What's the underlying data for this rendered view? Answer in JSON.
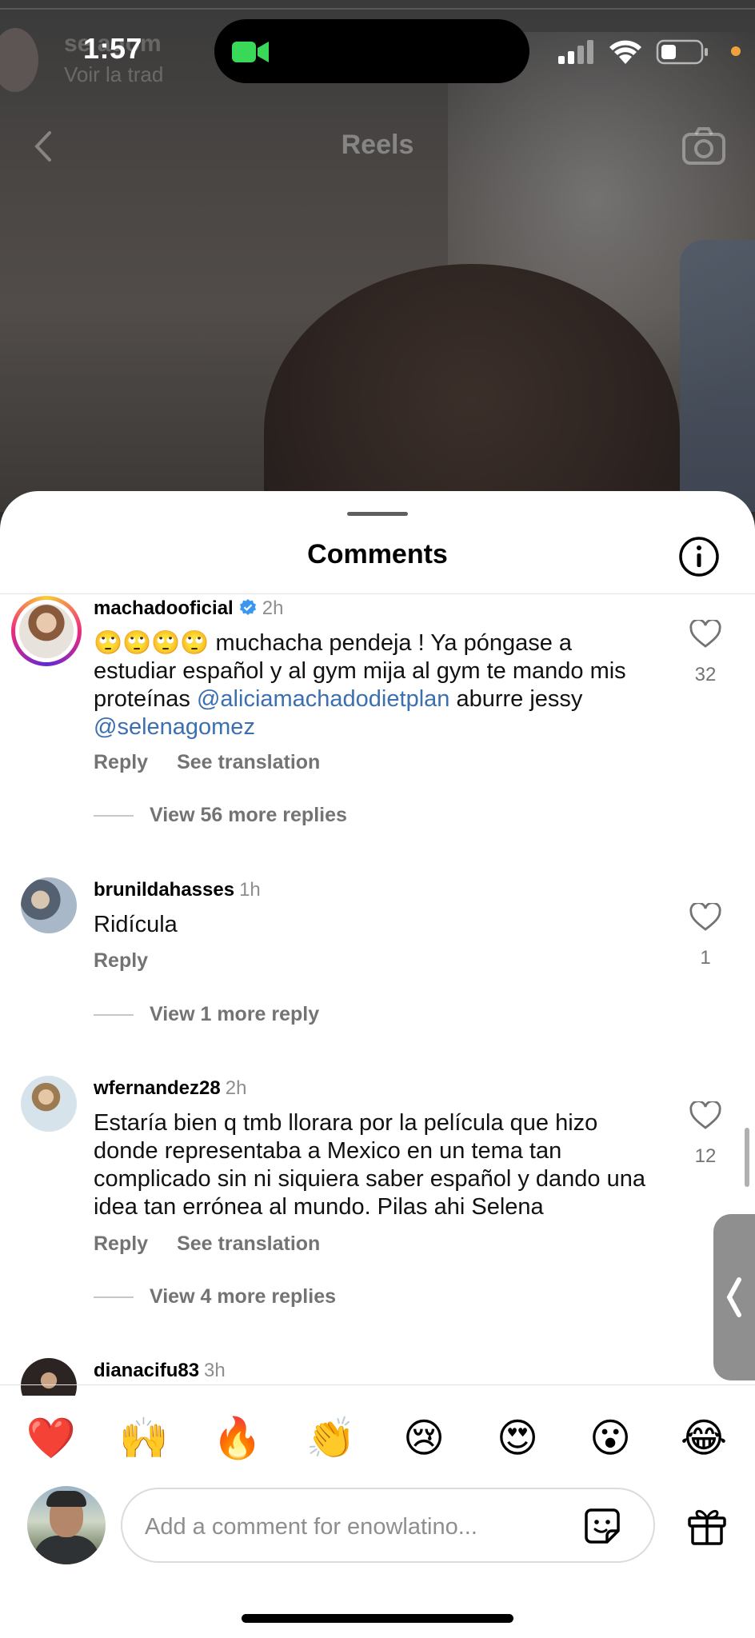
{
  "status_bar": {
    "time": "1:57"
  },
  "background": {
    "ghost_username": "selenagomez",
    "ghost_username_visible": "se  agom",
    "ghost_subtitle": "Voir la trad",
    "nav_title": "Reels"
  },
  "sheet": {
    "title": "Comments"
  },
  "comments": [
    {
      "username": "machadooficial",
      "verified": true,
      "time": "2h",
      "text_before": "🙄🙄🙄🙄 muchacha pendeja ! Ya póngase a estudiar español y al gym mija al gym te mando mis proteínas ",
      "mention1": "@aliciamachadodietplan",
      "text_middle": " aburre jessy ",
      "mention2": "@selenagomez",
      "reply": "Reply",
      "see_translation": "See translation",
      "view_more": "View 56 more replies",
      "likes": "32"
    },
    {
      "username": "brunildahasses",
      "time": "1h",
      "text": "Ridícula",
      "reply": "Reply",
      "view_more": "View 1 more reply",
      "likes": "1"
    },
    {
      "username": "wfernandez28",
      "time": "2h",
      "text": "Estaría bien q tmb llorara por la película que hizo donde representaba a Mexico en un tema tan complicado sin ni siquiera saber español y dando una idea tan errónea al mundo. Pilas ahi Selena",
      "reply": "Reply",
      "see_translation": "See translation",
      "view_more": "View 4 more replies",
      "likes": "12"
    },
    {
      "username": "dianacifu83",
      "time": "3h"
    }
  ],
  "emoji_bar": [
    "❤️",
    "🙌",
    "🔥",
    "👏",
    "😢",
    "😍",
    "😮",
    "😂"
  ],
  "composer": {
    "placeholder": "Add a comment for enowlatino..."
  },
  "icons": {
    "back": "chevron-left-icon",
    "camera": "camera-icon",
    "info": "info-icon",
    "like": "heart-icon",
    "sticker": "sticker-icon",
    "gift": "gift-icon"
  },
  "colors": {
    "mention": "#3b6fb0",
    "verified": "#3897f0",
    "secondary_text": "#737373",
    "battery_dot": "#f0a13b",
    "facetime_green": "#3ad858"
  }
}
